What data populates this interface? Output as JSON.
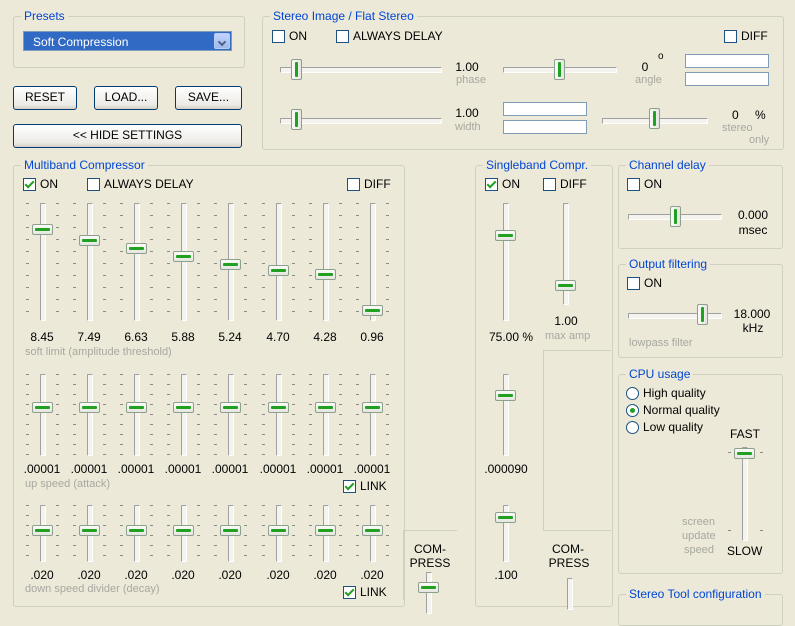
{
  "presets": {
    "title": "Presets",
    "selected": "Soft Compression"
  },
  "buttons": {
    "reset": "RESET",
    "load": "LOAD...",
    "save": "SAVE...",
    "hide_settings": "<< HIDE SETTINGS"
  },
  "stereo": {
    "title": "Stereo Image / Flat Stereo",
    "on_label": "ON",
    "always_delay_label": "ALWAYS DELAY",
    "diff_label": "DIFF",
    "phase_value": "1.00",
    "phase_label": "phase",
    "angle_value": "0",
    "angle_unit": "o",
    "angle_label": "angle",
    "width_value": "1.00",
    "width_label": "width",
    "stereo_only_value": "0",
    "stereo_only_unit": "%",
    "stereo_only_label_1": "stereo",
    "stereo_only_label_2": "only"
  },
  "multiband": {
    "title": "Multiband Compressor",
    "on_label": "ON",
    "on_checked": true,
    "always_delay_label": "ALWAYS DELAY",
    "diff_label": "DIFF",
    "soft_limit_values": [
      "8.45",
      "7.49",
      "6.63",
      "5.88",
      "5.24",
      "4.70",
      "4.28",
      "0.96"
    ],
    "soft_limit_fraction": [
      0.2,
      0.3,
      0.38,
      0.46,
      0.53,
      0.59,
      0.63,
      0.97
    ],
    "soft_limit_label": "soft limit (amplitude threshold)",
    "up_speed_values": [
      ".00001",
      ".00001",
      ".00001",
      ".00001",
      ".00001",
      ".00001",
      ".00001",
      ".00001"
    ],
    "up_speed_label": "up speed (attack)",
    "link_label": "LINK",
    "down_speed_values": [
      ".020",
      ".020",
      ".020",
      ".020",
      ".020",
      ".020",
      ".020",
      ".020"
    ],
    "down_speed_label": "down speed divider (decay)",
    "compress_label_1": "COM-",
    "compress_label_2": "PRESS"
  },
  "singleband": {
    "title": "Singleband Compr.",
    "on_label": "ON",
    "on_checked": true,
    "diff_label": "DIFF",
    "threshold_value": "75.00",
    "threshold_unit": "%",
    "max_amp_value": "1.00",
    "max_amp_label": "max amp",
    "attack_value": ".000090",
    "decay_value": ".100",
    "compress_label_1": "COM-",
    "compress_label_2": "PRESS"
  },
  "channel_delay": {
    "title": "Channel delay",
    "on_label": "ON",
    "value": "0.000",
    "unit": "msec"
  },
  "output_filtering": {
    "title": "Output filtering",
    "on_label": "ON",
    "value": "18.000",
    "unit": "kHz",
    "lowpass_label": "lowpass filter"
  },
  "cpu_usage": {
    "title": "CPU usage",
    "options": [
      "High quality",
      "Normal quality",
      "Low quality"
    ],
    "selected_index": 1,
    "fast_label": "FAST",
    "slow_label": "SLOW",
    "screen_update_1": "screen",
    "screen_update_2": "update",
    "screen_update_3": "speed"
  },
  "stereo_config": {
    "title": "Stereo Tool configuration"
  }
}
